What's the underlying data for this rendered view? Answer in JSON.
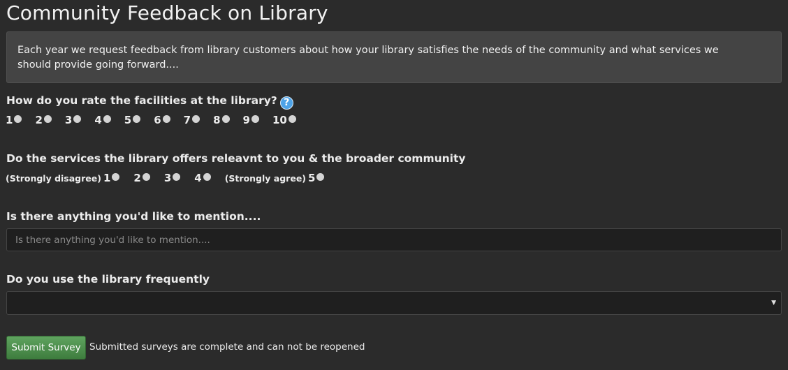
{
  "page": {
    "title": "Community Feedback on Library",
    "intro": "Each year we request feedback from library customers about how your library satisfies the needs of the community and what services we should provide going forward...."
  },
  "q1": {
    "label": "How do you rate the facilities at the library?",
    "help_icon": "?",
    "options": [
      "1",
      "2",
      "3",
      "4",
      "5",
      "6",
      "7",
      "8",
      "9",
      "10"
    ]
  },
  "q2": {
    "label": "Do the services the library offers releavnt to you & the broader community",
    "options": [
      {
        "prefix": "(Strongly disagree)",
        "value": "1"
      },
      {
        "prefix": "",
        "value": "2"
      },
      {
        "prefix": "",
        "value": "3"
      },
      {
        "prefix": "",
        "value": "4"
      },
      {
        "prefix": "(Strongly agree)",
        "value": "5"
      }
    ]
  },
  "q3": {
    "label": "Is there anything you'd like to mention....",
    "placeholder": "Is there anything you'd like to mention....",
    "value": ""
  },
  "q4": {
    "label": "Do you use the library frequently",
    "selected": "",
    "arrow": "▼"
  },
  "submit": {
    "label": "Submit Survey",
    "note": "Submitted surveys are complete and can not be reopened"
  },
  "colors": {
    "background": "#2b2b2b",
    "panel": "#444444",
    "submit_green": "#4e8f4e",
    "help_blue": "#4ea3e8"
  }
}
